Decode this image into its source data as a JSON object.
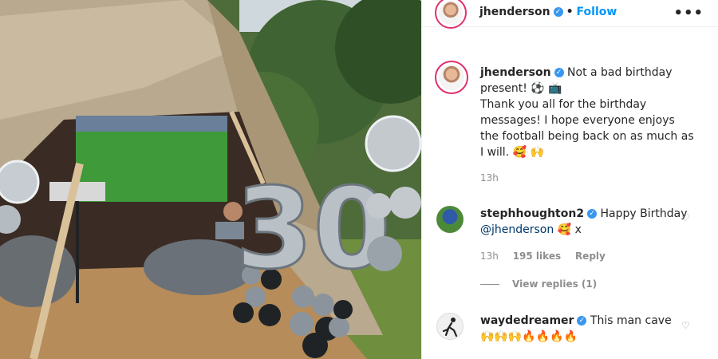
{
  "post": {
    "icons": {
      "verified": "verified-badge-icon",
      "more": "more-options-icon",
      "like": "heart-icon"
    }
  },
  "header": {
    "username": "jhenderson",
    "separator": "•",
    "follow_label": "Follow",
    "more_glyph": "•••"
  },
  "caption": {
    "username": "jhenderson",
    "line1": "Not a bad birthday present!",
    "emoji1": "⚽",
    "emoji2": "📺",
    "line2": "Thank you all for the birthday messages! I hope everyone enjoys the football being back on as much as I will.",
    "emoji3": "🥰",
    "emoji4": "🙌",
    "time": "13h"
  },
  "comments": [
    {
      "username": "stephhoughton2",
      "text_before": "Happy Birthday",
      "mention": "@jhenderson",
      "text_after": "🥰 x",
      "time": "13h",
      "likes": "195 likes",
      "reply_label": "Reply",
      "view_replies": "View replies (1)"
    },
    {
      "username": "waydedreamer",
      "text": "This man cave",
      "emojis": "🙌🙌🙌🔥🔥🔥🔥"
    }
  ],
  "photo": {
    "balloon_number": "30"
  },
  "colors": {
    "accent": "#0095f6",
    "verified": "#3897f0",
    "muted": "#8e8e8e",
    "text": "#262626",
    "story_ring": "#e1306c"
  }
}
